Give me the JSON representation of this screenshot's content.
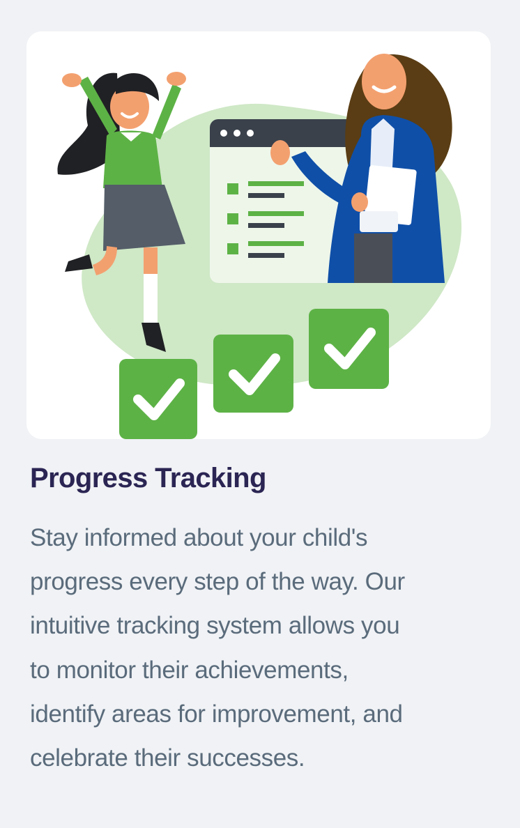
{
  "feature_card": {
    "image_alt": "",
    "title": "Progress Tracking",
    "description_lines": [
      "Stay informed about your child's",
      "progress every step of the way. Our",
      "intuitive tracking system allows you",
      "to monitor their achievements,",
      "identify areas for improvement, and",
      "celebrate their successes."
    ]
  },
  "colors": {
    "background": "#f0f2f5",
    "card_image_bg": "#ffffff",
    "title": "#2a2553",
    "body_text": "#5a6b7b",
    "accent_green": "#5db246",
    "light_green": "#cfe8c6",
    "teacher_blue": "#0f4fa8",
    "dark_panel": "#3a414b"
  },
  "icons": {
    "checkmark": "check-icon",
    "browser_dots": "window-dots-icon"
  }
}
